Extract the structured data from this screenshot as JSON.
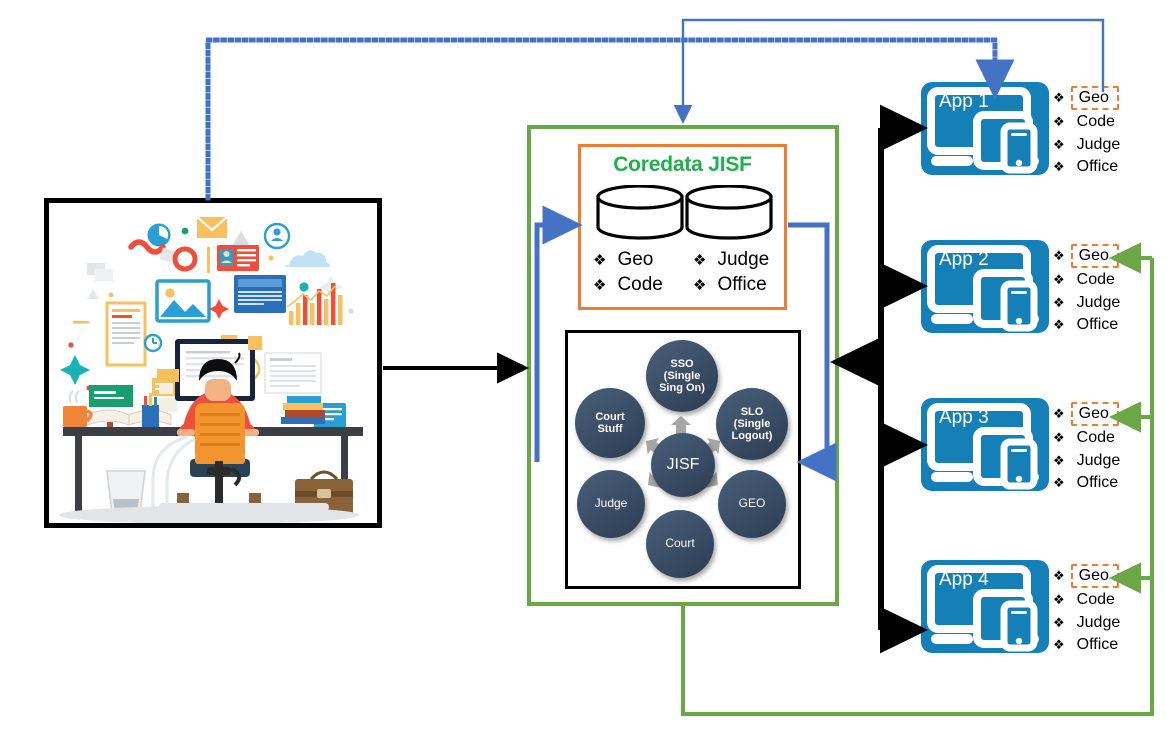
{
  "diagram": {
    "title": "JISF single sign-on integration architecture",
    "colors": {
      "green_container": "#6aa845",
      "orange_box": "#ed7d31",
      "green_title": "#1eaf4f",
      "app_blue": "#1580b8",
      "node_navy": "#3c5069",
      "blue_connector": "#4472c4",
      "black_connector": "#000000"
    }
  },
  "illustration": {
    "name": "person-working-at-desk-illustration",
    "alt": "Flat illustration of a person seated at a desk using a computer with floating media and document icons"
  },
  "coredata": {
    "title": "Coredata JISF",
    "bullet_mark": "❖",
    "columns": [
      {
        "items": [
          "Geo",
          "Code"
        ]
      },
      {
        "items": [
          "Judge",
          "Office"
        ]
      }
    ]
  },
  "hub": {
    "center": {
      "label": "JISF"
    },
    "nodes": [
      {
        "id": "sso",
        "label": "SSO\n(Single\nSing On)"
      },
      {
        "id": "slo",
        "label": "SLO\n(Single\nLogout)"
      },
      {
        "id": "geo",
        "label": "GEO"
      },
      {
        "id": "court",
        "label": "Court"
      },
      {
        "id": "judge",
        "label": "Judge"
      },
      {
        "id": "court-stuff",
        "label": "Court\nStuff"
      }
    ]
  },
  "apps": [
    {
      "id": "app-1",
      "label": "App 1",
      "bullet_mark": "❖",
      "items": [
        {
          "text": "Geo",
          "highlighted": true
        },
        {
          "text": "Code",
          "highlighted": false
        },
        {
          "text": "Judge",
          "highlighted": false
        },
        {
          "text": "Office",
          "highlighted": false
        }
      ]
    },
    {
      "id": "app-2",
      "label": "App 2",
      "bullet_mark": "❖",
      "items": [
        {
          "text": "Geo",
          "highlighted": true
        },
        {
          "text": "Code",
          "highlighted": false
        },
        {
          "text": "Judge",
          "highlighted": false
        },
        {
          "text": "Office",
          "highlighted": false
        }
      ]
    },
    {
      "id": "app-3",
      "label": "App 3",
      "bullet_mark": "❖",
      "items": [
        {
          "text": "Geo",
          "highlighted": true
        },
        {
          "text": "Code",
          "highlighted": false
        },
        {
          "text": "Judge",
          "highlighted": false
        },
        {
          "text": "Office",
          "highlighted": false
        }
      ]
    },
    {
      "id": "app-4",
      "label": "App 4",
      "bullet_mark": "❖",
      "items": [
        {
          "text": "Geo",
          "highlighted": true
        },
        {
          "text": "Code",
          "highlighted": false
        },
        {
          "text": "Judge",
          "highlighted": false
        },
        {
          "text": "Office",
          "highlighted": false
        }
      ]
    }
  ],
  "connectors": [
    {
      "id": "user-to-jisf",
      "style": "solid",
      "color": "#000000",
      "note": "User workstation to JISF container"
    },
    {
      "id": "user-to-app1",
      "style": "dotted",
      "color": "#4472c4",
      "note": "User workstation up and across to App 1"
    },
    {
      "id": "app1-geo-to-jisf",
      "style": "solid",
      "color": "#4472c4",
      "note": "App 1 Geo back to JISF container"
    },
    {
      "id": "coredata-loop-in",
      "style": "solid",
      "color": "#4472c4",
      "note": "Loop into Coredata JISF store"
    },
    {
      "id": "coredata-loop-out",
      "style": "solid",
      "color": "#4472c4",
      "note": "Coredata out to hub box"
    },
    {
      "id": "jisf-bus-to-apps",
      "style": "solid",
      "color": "#000000",
      "note": "Black bus fanning out to App 1-4"
    },
    {
      "id": "apps-back-to-jisf",
      "style": "solid",
      "color": "#000000",
      "note": "Apps bus returning into JISF container"
    },
    {
      "id": "green-geo-feed",
      "style": "solid",
      "color": "#6aa845",
      "note": "Green feed from container to Geo of Apps 2, 3 and 4"
    }
  ]
}
